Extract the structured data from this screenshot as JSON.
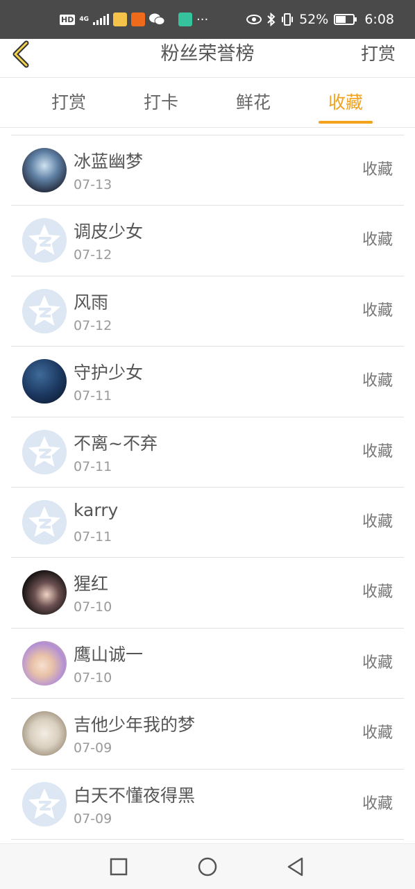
{
  "status_bar": {
    "network_type": "4G",
    "battery_percent": "52%",
    "battery_level": 0.52,
    "time": "6:08",
    "more": "···",
    "icons": [
      "hd-icon",
      "signal-icon",
      "app-icon",
      "taobao-icon",
      "wechat-icon",
      "app-icon",
      "eye-comfort-icon",
      "bluetooth-icon",
      "vibrate-icon",
      "battery-icon"
    ]
  },
  "header": {
    "title": "粉丝荣誉榜",
    "action_label": "打赏",
    "back_icon": "chevron-left-icon"
  },
  "tabs": [
    {
      "label": "打赏",
      "active": false
    },
    {
      "label": "打卡",
      "active": false
    },
    {
      "label": "鲜花",
      "active": false
    },
    {
      "label": "收藏",
      "active": true
    }
  ],
  "accent_color": "#f2a21b",
  "list": [
    {
      "name": "冰蓝幽梦",
      "date": "07-13",
      "action": "收藏",
      "avatar": "photo"
    },
    {
      "name": "调皮少女",
      "date": "07-12",
      "action": "收藏",
      "avatar": "default"
    },
    {
      "name": "风雨",
      "date": "07-12",
      "action": "收藏",
      "avatar": "default"
    },
    {
      "name": "守护少女",
      "date": "07-11",
      "action": "收藏",
      "avatar": "photo"
    },
    {
      "name": "不离~不弃",
      "date": "07-11",
      "action": "收藏",
      "avatar": "default"
    },
    {
      "name": "karry",
      "date": "07-11",
      "action": "收藏",
      "avatar": "default"
    },
    {
      "name": "猩红",
      "date": "07-10",
      "action": "收藏",
      "avatar": "photo"
    },
    {
      "name": "鹰山诚一",
      "date": "07-10",
      "action": "收藏",
      "avatar": "photo"
    },
    {
      "name": "吉他少年我的梦",
      "date": "07-09",
      "action": "收藏",
      "avatar": "photo"
    },
    {
      "name": "白天不懂夜得黑",
      "date": "07-09",
      "action": "收藏",
      "avatar": "default"
    }
  ],
  "nav_bar": {
    "icons": [
      "recents-square-icon",
      "home-circle-icon",
      "back-triangle-icon"
    ]
  }
}
